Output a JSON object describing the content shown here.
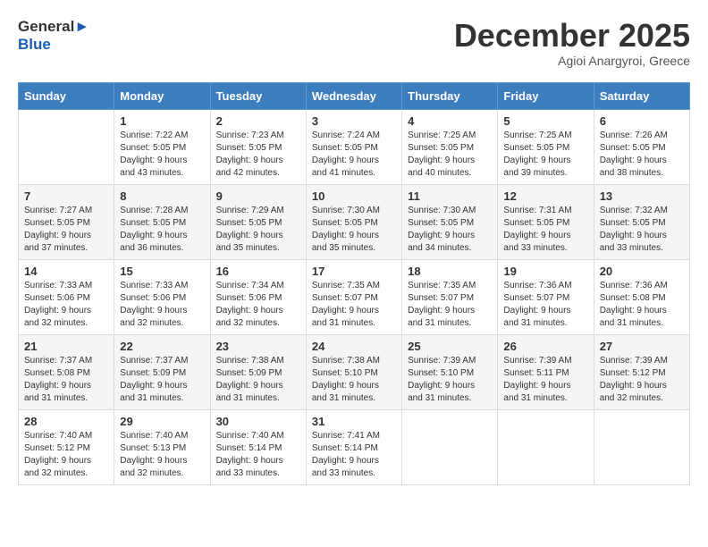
{
  "header": {
    "logo_line1": "General",
    "logo_line2": "Blue",
    "month": "December 2025",
    "location": "Agioi Anargyroi, Greece"
  },
  "columns": [
    "Sunday",
    "Monday",
    "Tuesday",
    "Wednesday",
    "Thursday",
    "Friday",
    "Saturday"
  ],
  "weeks": [
    [
      {
        "day": "",
        "info": ""
      },
      {
        "day": "1",
        "info": "Sunrise: 7:22 AM\nSunset: 5:05 PM\nDaylight: 9 hours\nand 43 minutes."
      },
      {
        "day": "2",
        "info": "Sunrise: 7:23 AM\nSunset: 5:05 PM\nDaylight: 9 hours\nand 42 minutes."
      },
      {
        "day": "3",
        "info": "Sunrise: 7:24 AM\nSunset: 5:05 PM\nDaylight: 9 hours\nand 41 minutes."
      },
      {
        "day": "4",
        "info": "Sunrise: 7:25 AM\nSunset: 5:05 PM\nDaylight: 9 hours\nand 40 minutes."
      },
      {
        "day": "5",
        "info": "Sunrise: 7:25 AM\nSunset: 5:05 PM\nDaylight: 9 hours\nand 39 minutes."
      },
      {
        "day": "6",
        "info": "Sunrise: 7:26 AM\nSunset: 5:05 PM\nDaylight: 9 hours\nand 38 minutes."
      }
    ],
    [
      {
        "day": "7",
        "info": "Sunrise: 7:27 AM\nSunset: 5:05 PM\nDaylight: 9 hours\nand 37 minutes."
      },
      {
        "day": "8",
        "info": "Sunrise: 7:28 AM\nSunset: 5:05 PM\nDaylight: 9 hours\nand 36 minutes."
      },
      {
        "day": "9",
        "info": "Sunrise: 7:29 AM\nSunset: 5:05 PM\nDaylight: 9 hours\nand 35 minutes."
      },
      {
        "day": "10",
        "info": "Sunrise: 7:30 AM\nSunset: 5:05 PM\nDaylight: 9 hours\nand 35 minutes."
      },
      {
        "day": "11",
        "info": "Sunrise: 7:30 AM\nSunset: 5:05 PM\nDaylight: 9 hours\nand 34 minutes."
      },
      {
        "day": "12",
        "info": "Sunrise: 7:31 AM\nSunset: 5:05 PM\nDaylight: 9 hours\nand 33 minutes."
      },
      {
        "day": "13",
        "info": "Sunrise: 7:32 AM\nSunset: 5:05 PM\nDaylight: 9 hours\nand 33 minutes."
      }
    ],
    [
      {
        "day": "14",
        "info": "Sunrise: 7:33 AM\nSunset: 5:06 PM\nDaylight: 9 hours\nand 32 minutes."
      },
      {
        "day": "15",
        "info": "Sunrise: 7:33 AM\nSunset: 5:06 PM\nDaylight: 9 hours\nand 32 minutes."
      },
      {
        "day": "16",
        "info": "Sunrise: 7:34 AM\nSunset: 5:06 PM\nDaylight: 9 hours\nand 32 minutes."
      },
      {
        "day": "17",
        "info": "Sunrise: 7:35 AM\nSunset: 5:07 PM\nDaylight: 9 hours\nand 31 minutes."
      },
      {
        "day": "18",
        "info": "Sunrise: 7:35 AM\nSunset: 5:07 PM\nDaylight: 9 hours\nand 31 minutes."
      },
      {
        "day": "19",
        "info": "Sunrise: 7:36 AM\nSunset: 5:07 PM\nDaylight: 9 hours\nand 31 minutes."
      },
      {
        "day": "20",
        "info": "Sunrise: 7:36 AM\nSunset: 5:08 PM\nDaylight: 9 hours\nand 31 minutes."
      }
    ],
    [
      {
        "day": "21",
        "info": "Sunrise: 7:37 AM\nSunset: 5:08 PM\nDaylight: 9 hours\nand 31 minutes."
      },
      {
        "day": "22",
        "info": "Sunrise: 7:37 AM\nSunset: 5:09 PM\nDaylight: 9 hours\nand 31 minutes."
      },
      {
        "day": "23",
        "info": "Sunrise: 7:38 AM\nSunset: 5:09 PM\nDaylight: 9 hours\nand 31 minutes."
      },
      {
        "day": "24",
        "info": "Sunrise: 7:38 AM\nSunset: 5:10 PM\nDaylight: 9 hours\nand 31 minutes."
      },
      {
        "day": "25",
        "info": "Sunrise: 7:39 AM\nSunset: 5:10 PM\nDaylight: 9 hours\nand 31 minutes."
      },
      {
        "day": "26",
        "info": "Sunrise: 7:39 AM\nSunset: 5:11 PM\nDaylight: 9 hours\nand 31 minutes."
      },
      {
        "day": "27",
        "info": "Sunrise: 7:39 AM\nSunset: 5:12 PM\nDaylight: 9 hours\nand 32 minutes."
      }
    ],
    [
      {
        "day": "28",
        "info": "Sunrise: 7:40 AM\nSunset: 5:12 PM\nDaylight: 9 hours\nand 32 minutes."
      },
      {
        "day": "29",
        "info": "Sunrise: 7:40 AM\nSunset: 5:13 PM\nDaylight: 9 hours\nand 32 minutes."
      },
      {
        "day": "30",
        "info": "Sunrise: 7:40 AM\nSunset: 5:14 PM\nDaylight: 9 hours\nand 33 minutes."
      },
      {
        "day": "31",
        "info": "Sunrise: 7:41 AM\nSunset: 5:14 PM\nDaylight: 9 hours\nand 33 minutes."
      },
      {
        "day": "",
        "info": ""
      },
      {
        "day": "",
        "info": ""
      },
      {
        "day": "",
        "info": ""
      }
    ]
  ]
}
